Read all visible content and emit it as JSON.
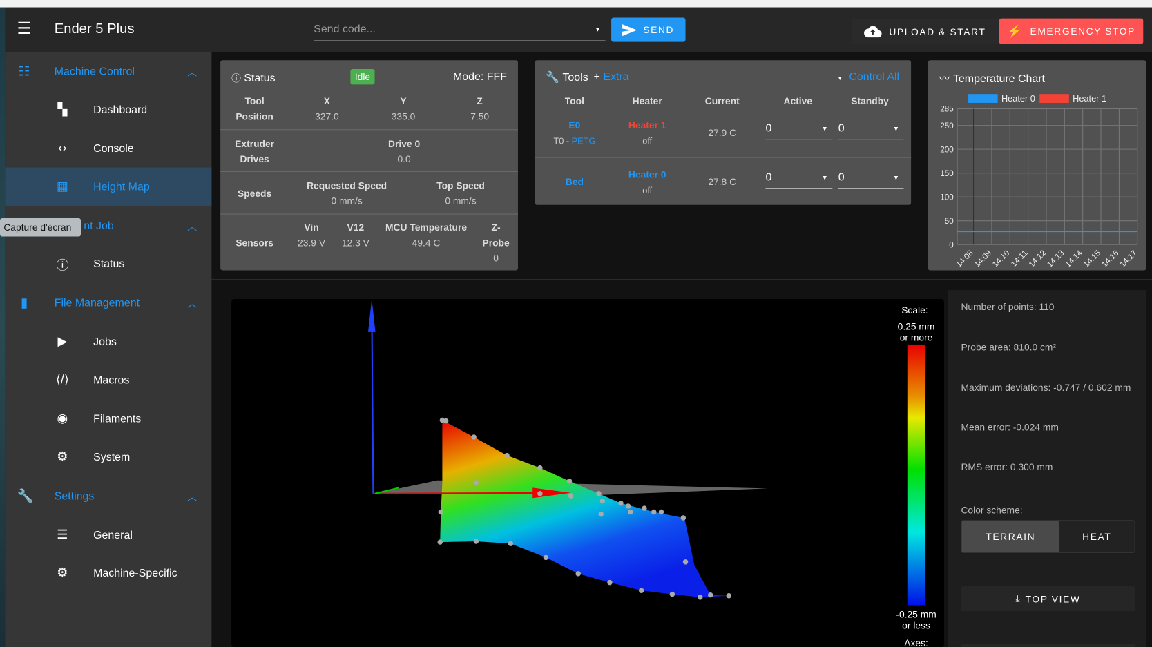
{
  "app": {
    "title": "Ender 5 Plus",
    "send_placeholder": "Send code...",
    "send_label": "SEND",
    "upload_label": "UPLOAD & START",
    "estop_label": "EMERGENCY STOP",
    "tooltip": "Capture d'écran"
  },
  "sidebar": {
    "groups": [
      {
        "label": "Machine Control",
        "icon": "tune-icon",
        "items": [
          {
            "label": "Dashboard",
            "icon": "dashboard-icon"
          },
          {
            "label": "Console",
            "icon": "code-icon"
          },
          {
            "label": "Height Map",
            "icon": "grid-icon",
            "active": true
          }
        ]
      },
      {
        "visible_label": "nt Job",
        "icon": "job-icon",
        "items": [
          {
            "label": "Status",
            "icon": "info-icon"
          }
        ]
      },
      {
        "label": "File Management",
        "icon": "sd-card-icon",
        "items": [
          {
            "label": "Jobs",
            "icon": "play-icon"
          },
          {
            "label": "Macros",
            "icon": "macro-icon"
          },
          {
            "label": "Filaments",
            "icon": "radio-icon"
          },
          {
            "label": "System",
            "icon": "gear-icon"
          }
        ]
      },
      {
        "label": "Settings",
        "icon": "wrench-icon",
        "items": [
          {
            "label": "General",
            "icon": "sliders-icon"
          },
          {
            "label": "Machine-Specific",
            "icon": "gears-icon"
          }
        ]
      }
    ]
  },
  "status": {
    "title": "Status",
    "badge": "Idle",
    "mode": "Mode: FFF",
    "position": {
      "label1": "Tool",
      "label2": "Position",
      "axes": [
        {
          "name": "X",
          "value": "327.0"
        },
        {
          "name": "Y",
          "value": "335.0"
        },
        {
          "name": "Z",
          "value": "7.50"
        }
      ]
    },
    "extruder": {
      "label1": "Extruder",
      "label2": "Drives",
      "drive": "Drive 0",
      "value": "0.0"
    },
    "speeds": {
      "label": "Speeds",
      "requested": "Requested Speed",
      "requested_value": "0 mm/s",
      "top": "Top Speed",
      "top_value": "0 mm/s"
    },
    "sensors": {
      "label": "Sensors",
      "vin": "Vin",
      "vin_value": "23.9 V",
      "v12": "V12",
      "v12_value": "12.3 V",
      "mcu": "MCU Temperature",
      "mcu_value": "49.4 C",
      "zprobe1": "Z-",
      "zprobe2": "Probe",
      "zprobe_value": "0"
    }
  },
  "tools": {
    "title": "Tools",
    "extra": "Extra",
    "control_all": "Control All",
    "headers": [
      "Tool",
      "Heater",
      "Current",
      "Active",
      "Standby"
    ],
    "rows": [
      {
        "tool": "E0",
        "sub1": "T0 - ",
        "sub2": "PETG",
        "heater": "Heater 1",
        "heater_color": "#f44336",
        "state": "off",
        "current": "27.9 C",
        "active": "0",
        "standby": "0"
      },
      {
        "tool": "Bed",
        "heater": "Heater 0",
        "heater_color": "#2196f3",
        "state": "off",
        "current": "27.8 C",
        "active": "0",
        "standby": "0"
      }
    ]
  },
  "chart_data": {
    "type": "line",
    "title": "Temperature Chart",
    "legend": "top",
    "grid": true,
    "categories": [
      "14:08",
      "14:09",
      "14:10",
      "14:11",
      "14:12",
      "14:13",
      "14:14",
      "14:15",
      "14:16",
      "14:17"
    ],
    "yticks": [
      "285",
      "250",
      "200",
      "150",
      "100",
      "50",
      "0"
    ],
    "ylim": [
      0,
      285
    ],
    "series": [
      {
        "name": "Heater 0",
        "color": "#2196f3",
        "values": [
          27.8,
          27.8,
          27.8,
          27.8,
          27.8,
          27.8,
          27.8,
          27.8,
          27.8,
          27.8
        ]
      },
      {
        "name": "Heater 1",
        "color": "#f44336",
        "values": []
      }
    ]
  },
  "heightmap": {
    "scale_label": "Scale:",
    "max1": "0.25 mm",
    "max2": "or more",
    "min1": "-0.25 mm",
    "min2": "or less",
    "axes_label": "Axes:"
  },
  "stats": {
    "points": "Number of points: 110",
    "area": "Probe area: 810.0 cm²",
    "deviation": "Maximum deviations: -0.747 / 0.602 mm",
    "mean": "Mean error: -0.024 mm",
    "rms": "RMS error: 0.300 mm",
    "scheme_label": "Color scheme:",
    "terrain": "TERRAIN",
    "heat": "HEAT",
    "top_view": "TOP VIEW"
  },
  "colors": {
    "accent": "#2196f3",
    "estop": "#ff5252",
    "idle": "#4caf50"
  }
}
